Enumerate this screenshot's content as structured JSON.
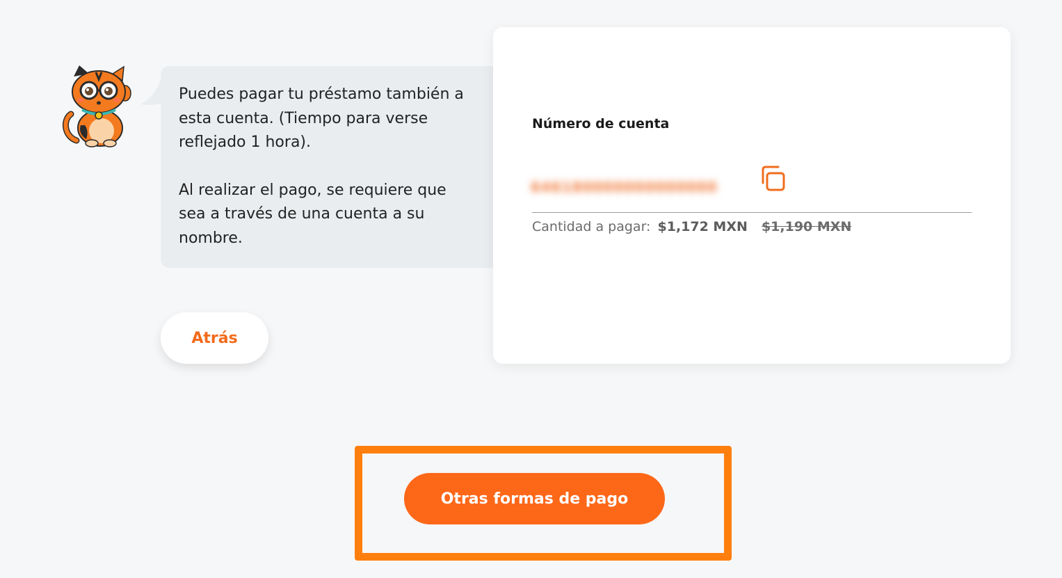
{
  "chat": {
    "mascot_icon": "orange-cat-mascot",
    "message_paragraph_1": "Puedes pagar tu préstamo también a esta cuenta. (Tiempo para verse reflejado 1 hora).",
    "message_paragraph_2": "Al realizar el pago, se requiere que sea a través de una cuenta a su nombre."
  },
  "actions": {
    "back_label": "Atrás",
    "other_payments_label": "Otras formas de pago"
  },
  "account": {
    "label": "Número de cuenta",
    "number": "646180000000000000",
    "copy_icon": "copy-icon",
    "amount_label": "Cantidad a pagar:",
    "amount_current": "$1,172 MXN",
    "amount_original": "$1,190 MXN"
  },
  "colors": {
    "accent": "#fd6718",
    "highlight": "#ff7f0e",
    "bubble": "#e9edf0",
    "background": "#f6f7f8"
  }
}
